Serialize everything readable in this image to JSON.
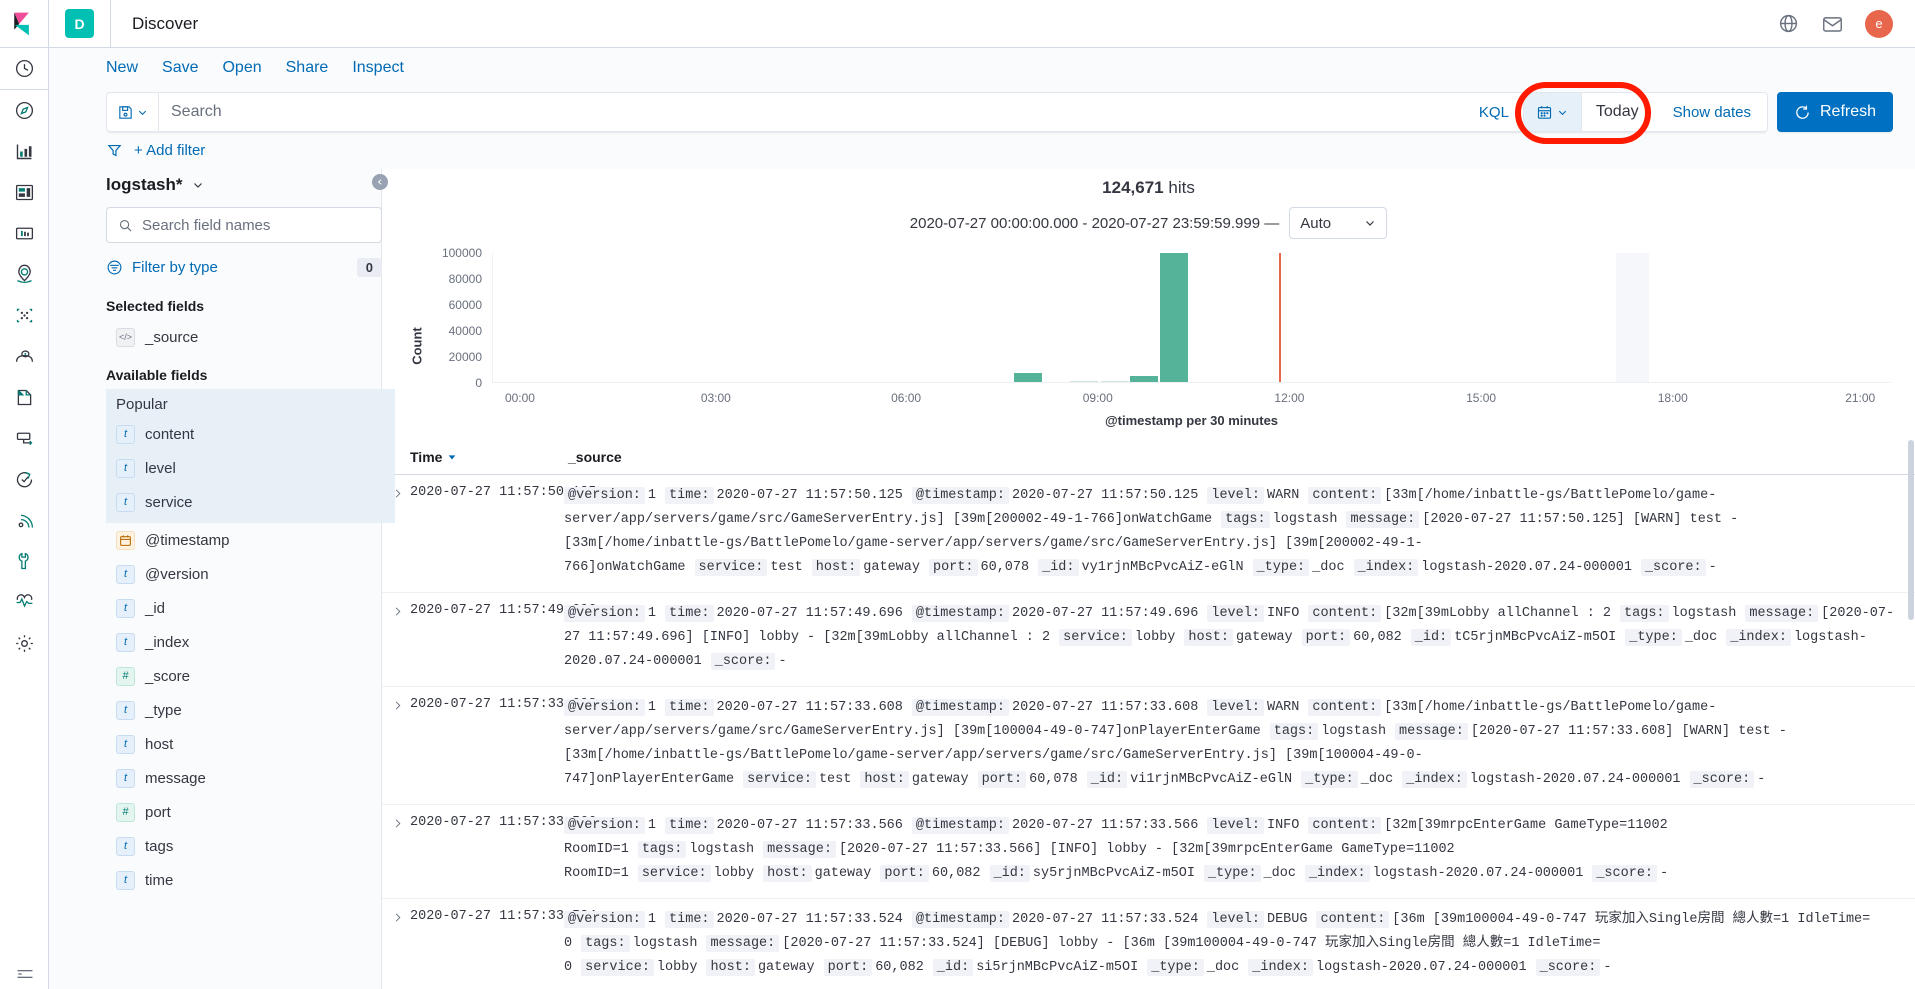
{
  "chrome": {
    "app_badge": "D",
    "title": "Discover",
    "icons": [
      "help-icon",
      "mail-icon"
    ],
    "avatar_initial": "e"
  },
  "menu": {
    "items": [
      {
        "label": "New",
        "name": "menu-new"
      },
      {
        "label": "Save",
        "name": "menu-save"
      },
      {
        "label": "Open",
        "name": "menu-open"
      },
      {
        "label": "Share",
        "name": "menu-share"
      },
      {
        "label": "Inspect",
        "name": "menu-inspect"
      }
    ]
  },
  "query_bar": {
    "search_value": "",
    "search_placeholder": "Search",
    "language": "KQL",
    "date_label": "Today",
    "show_dates": "Show dates",
    "refresh": "Refresh",
    "highlight_color": "#ff1a00"
  },
  "filter_bar": {
    "add_filter": "+ Add filter"
  },
  "sidebar": {
    "index_pattern": "logstash*",
    "field_search_placeholder": "Search field names",
    "field_search_value": "",
    "filter_by_type": "Filter by type",
    "filter_count": "0",
    "selected_fields_title": "Selected fields",
    "selected_fields": [
      {
        "name": "_source",
        "type": "s",
        "glyph": "</>"
      }
    ],
    "available_fields_title": "Available fields",
    "popular_label": "Popular",
    "popular_fields": [
      {
        "name": "content",
        "type": "t",
        "glyph": "t"
      },
      {
        "name": "level",
        "type": "t",
        "glyph": "t"
      },
      {
        "name": "service",
        "type": "t",
        "glyph": "t"
      }
    ],
    "other_fields": [
      {
        "name": "@timestamp",
        "type": "d",
        "glyph": "▦"
      },
      {
        "name": "@version",
        "type": "t",
        "glyph": "t"
      },
      {
        "name": "_id",
        "type": "t",
        "glyph": "t"
      },
      {
        "name": "_index",
        "type": "t",
        "glyph": "t"
      },
      {
        "name": "_score",
        "type": "n",
        "glyph": "#"
      },
      {
        "name": "_type",
        "type": "t",
        "glyph": "t"
      },
      {
        "name": "host",
        "type": "t",
        "glyph": "t"
      },
      {
        "name": "message",
        "type": "t",
        "glyph": "t"
      },
      {
        "name": "port",
        "type": "n",
        "glyph": "#"
      },
      {
        "name": "tags",
        "type": "t",
        "glyph": "t"
      },
      {
        "name": "time",
        "type": "t",
        "glyph": "t"
      }
    ]
  },
  "results": {
    "hits_count": "124,671",
    "hits_label": "hits",
    "range_text": "2020-07-27 00:00:00.000 - 2020-07-27 23:59:59.999 —",
    "interval": "Auto",
    "columns": {
      "time": "Time",
      "source": "_source"
    }
  },
  "chart_data": {
    "type": "bar",
    "title": "",
    "xlabel": "@timestamp per 30 minutes",
    "ylabel": "Count",
    "ylim": [
      0,
      100000
    ],
    "yticks": [
      0,
      20000,
      40000,
      60000,
      80000,
      100000
    ],
    "xticks": [
      "00:00",
      "03:00",
      "06:00",
      "09:00",
      "12:00",
      "15:00",
      "18:00",
      "21:00"
    ],
    "xlim": [
      "00:00",
      "24:00"
    ],
    "grid": false,
    "legend": "none",
    "bar_color": "#54b399",
    "marker_color": "#e7664c",
    "categories": [
      "09:00",
      "09:30",
      "10:00",
      "10:30",
      "11:00",
      "11:30"
    ],
    "values": [
      7000,
      0,
      500,
      700,
      6000,
      100000
    ],
    "annotations": [
      {
        "type": "vertical-line",
        "x": "13:45",
        "color": "#e7664c",
        "name": "current-time-marker"
      },
      {
        "type": "shaded-region",
        "x_start": "19:30",
        "x_end": "20:30",
        "color": "#f5f7fa"
      }
    ]
  },
  "documents": [
    {
      "time": "2020-07-27 11:57:50.125",
      "fields": [
        {
          "k": "@version:",
          "v": "1"
        },
        {
          "k": "time:",
          "v": "2020-07-27 11:57:50.125"
        },
        {
          "k": "@timestamp:",
          "v": "2020-07-27 11:57:50.125"
        },
        {
          "k": "level:",
          "v": "WARN"
        },
        {
          "k": "content:",
          "v": "[33m[/home/inbattle-gs/BattlePomelo/game-server/app/servers/game/src/GameServerEntry.js]  [39m[200002-49-1-766]onWatchGame"
        },
        {
          "k": "tags:",
          "v": "logstash"
        },
        {
          "k": "message:",
          "v": "[2020-07-27 11:57:50.125] [WARN] test -  [33m[/home/inbattle-gs/BattlePomelo/game-server/app/servers/game/src/GameServerEntry.js]  [39m[200002-49-1-766]onWatchGame"
        },
        {
          "k": "service:",
          "v": "test"
        },
        {
          "k": "host:",
          "v": "gateway"
        },
        {
          "k": "port:",
          "v": "60,078"
        },
        {
          "k": "_id:",
          "v": "vy1rjnMBcPvcAiZ-eGlN"
        },
        {
          "k": "_type:",
          "v": "_doc"
        },
        {
          "k": "_index:",
          "v": "logstash-2020.07.24-000001"
        },
        {
          "k": "_score:",
          "v": "-"
        }
      ]
    },
    {
      "time": "2020-07-27 11:57:49.696",
      "fields": [
        {
          "k": "@version:",
          "v": "1"
        },
        {
          "k": "time:",
          "v": "2020-07-27 11:57:49.696"
        },
        {
          "k": "@timestamp:",
          "v": "2020-07-27 11:57:49.696"
        },
        {
          "k": "level:",
          "v": "INFO"
        },
        {
          "k": "content:",
          "v": "[32m[39mLobby allChannel : 2"
        },
        {
          "k": "tags:",
          "v": "logstash"
        },
        {
          "k": "message:",
          "v": "[2020-07-27 11:57:49.696] [INFO] lobby -  [32m[39mLobby allChannel : 2"
        },
        {
          "k": "service:",
          "v": "lobby"
        },
        {
          "k": "host:",
          "v": "gateway"
        },
        {
          "k": "port:",
          "v": "60,082"
        },
        {
          "k": "_id:",
          "v": "tC5rjnMBcPvcAiZ-m5OI"
        },
        {
          "k": "_type:",
          "v": "_doc"
        },
        {
          "k": "_index:",
          "v": "logstash-2020.07.24-000001"
        },
        {
          "k": "_score:",
          "v": "-"
        }
      ]
    },
    {
      "time": "2020-07-27 11:57:33.608",
      "fields": [
        {
          "k": "@version:",
          "v": "1"
        },
        {
          "k": "time:",
          "v": "2020-07-27 11:57:33.608"
        },
        {
          "k": "@timestamp:",
          "v": "2020-07-27 11:57:33.608"
        },
        {
          "k": "level:",
          "v": "WARN"
        },
        {
          "k": "content:",
          "v": "[33m[/home/inbattle-gs/BattlePomelo/game-server/app/servers/game/src/GameServerEntry.js]  [39m[100004-49-0-747]onPlayerEnterGame"
        },
        {
          "k": "tags:",
          "v": "logstash"
        },
        {
          "k": "message:",
          "v": "[2020-07-27 11:57:33.608] [WARN] test -  [33m[/home/inbattle-gs/BattlePomelo/game-server/app/servers/game/src/GameServerEntry.js]  [39m[100004-49-0-747]onPlayerEnterGame"
        },
        {
          "k": "service:",
          "v": "test"
        },
        {
          "k": "host:",
          "v": "gateway"
        },
        {
          "k": "port:",
          "v": "60,078"
        },
        {
          "k": "_id:",
          "v": "vi1rjnMBcPvcAiZ-eGlN"
        },
        {
          "k": "_type:",
          "v": "_doc"
        },
        {
          "k": "_index:",
          "v": "logstash-2020.07.24-000001"
        },
        {
          "k": "_score:",
          "v": "-"
        }
      ]
    },
    {
      "time": "2020-07-27 11:57:33.566",
      "fields": [
        {
          "k": "@version:",
          "v": "1"
        },
        {
          "k": "time:",
          "v": "2020-07-27 11:57:33.566"
        },
        {
          "k": "@timestamp:",
          "v": "2020-07-27 11:57:33.566"
        },
        {
          "k": "level:",
          "v": "INFO"
        },
        {
          "k": "content:",
          "v": "[32m[39mrpcEnterGame GameType=11002 RoomID=1"
        },
        {
          "k": "tags:",
          "v": "logstash"
        },
        {
          "k": "message:",
          "v": "[2020-07-27 11:57:33.566] [INFO] lobby -  [32m[39mrpcEnterGame GameType=11002 RoomID=1"
        },
        {
          "k": "service:",
          "v": "lobby"
        },
        {
          "k": "host:",
          "v": "gateway"
        },
        {
          "k": "port:",
          "v": "60,082"
        },
        {
          "k": "_id:",
          "v": "sy5rjnMBcPvcAiZ-m5OI"
        },
        {
          "k": "_type:",
          "v": "_doc"
        },
        {
          "k": "_index:",
          "v": "logstash-2020.07.24-000001"
        },
        {
          "k": "_score:",
          "v": "-"
        }
      ]
    },
    {
      "time": "2020-07-27 11:57:33.524",
      "fields": [
        {
          "k": "@version:",
          "v": "1"
        },
        {
          "k": "time:",
          "v": "2020-07-27 11:57:33.524"
        },
        {
          "k": "@timestamp:",
          "v": "2020-07-27 11:57:33.524"
        },
        {
          "k": "level:",
          "v": "DEBUG"
        },
        {
          "k": "content:",
          "v": "[36m [39m100004-49-0-747 玩家加入Single房間 總人數=1 IdleTime= 0"
        },
        {
          "k": "tags:",
          "v": "logstash"
        },
        {
          "k": "message:",
          "v": "[2020-07-27 11:57:33.524] [DEBUG] lobby -  [36m [39m100004-49-0-747 玩家加入Single房間 總人數=1 IdleTime= 0"
        },
        {
          "k": "service:",
          "v": "lobby"
        },
        {
          "k": "host:",
          "v": "gateway"
        },
        {
          "k": "port:",
          "v": "60,082"
        },
        {
          "k": "_id:",
          "v": "si5rjnMBcPvcAiZ-m5OI"
        },
        {
          "k": "_type:",
          "v": "_doc"
        },
        {
          "k": "_index:",
          "v": "logstash-2020.07.24-000001"
        },
        {
          "k": "_score:",
          "v": "-"
        }
      ]
    }
  ],
  "navrail": {
    "items": [
      {
        "name": "recently-viewed-icon"
      },
      {
        "name": "discover-compass-icon"
      },
      {
        "name": "visualize-barchart-icon"
      },
      {
        "name": "dashboard-icon"
      },
      {
        "name": "canvas-icon"
      },
      {
        "name": "maps-icon"
      },
      {
        "name": "machine-learning-icon"
      },
      {
        "name": "infrastructure-icon"
      },
      {
        "name": "logs-icon"
      },
      {
        "name": "apm-icon"
      },
      {
        "name": "uptime-icon"
      },
      {
        "name": "siem-icon"
      },
      {
        "name": "dev-tools-wrench-icon"
      },
      {
        "name": "monitoring-heartbeat-icon"
      },
      {
        "name": "management-gear-icon"
      }
    ],
    "bottom": {
      "name": "collapse-nav-icon"
    }
  }
}
